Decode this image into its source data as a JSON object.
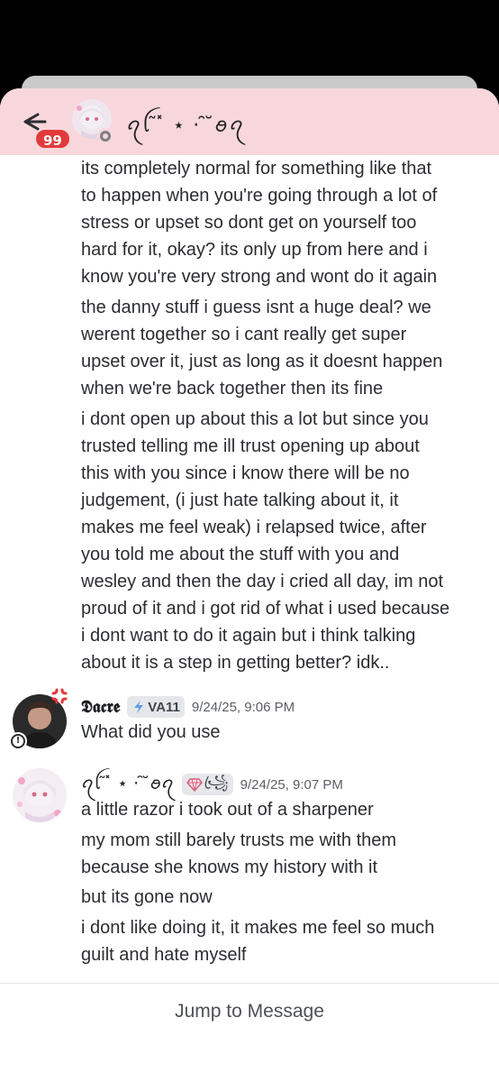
{
  "header": {
    "unread_count": "99",
    "channel_name": "ꪖꪶ ̃ ̽ ⋆ · ̑ ̆ꪮꪖ",
    "back_icon": "arrow-left-icon"
  },
  "messages": {
    "continued_lines": [
      "its completely normal for something like that",
      "to happen when you're going through a lot of",
      "stress or upset so dont get on yourself too",
      "hard for it, okay? its only up from here and i",
      "know you're very strong and wont do it again",
      "the danny stuff i guess isnt a huge deal? we",
      "werent together so i cant really get super",
      "upset over it, just as long as it doesnt happen",
      "when we're back together then its fine",
      "i dont open up about this a lot but since you",
      "trusted telling me ill trust opening up about",
      "this with you since i know there will be no",
      "judgement, (i just hate talking about it, it",
      "makes me feel weak) i relapsed twice, after",
      "you told me about the stuff with you and",
      "wesley and then the day i cried all day, im not",
      "proud of it and i got rid of what i used because",
      "i dont want to do it again but i think talking",
      "about it is a step in getting better? idk.."
    ],
    "group_dacre": {
      "author": "𝕯𝖆𝖈𝖗𝖊",
      "tag": "VA11",
      "timestamp": "9/24/25, 9:06 PM",
      "lines": [
        "What did you use"
      ]
    },
    "group_second": {
      "author": "ꪖꪶ ̃ ̽ ⋆ · ̑ ̆ꪮꪖ",
      "tag": "꧁ꦿ",
      "timestamp": "9/24/25, 9:07 PM",
      "lines": [
        "a little razor i took out of a sharpener",
        "my mom still barely trusts me with them",
        "because she knows my history with it",
        "but its gone now",
        "i dont like doing it, it makes me feel so much",
        "guilt and hate myself"
      ]
    }
  },
  "footer": {
    "jump_label": "Jump to Message"
  },
  "colors": {
    "header_bg": "#f7d7dc",
    "badge": "#e23a3a",
    "text": "#2b2d31"
  }
}
